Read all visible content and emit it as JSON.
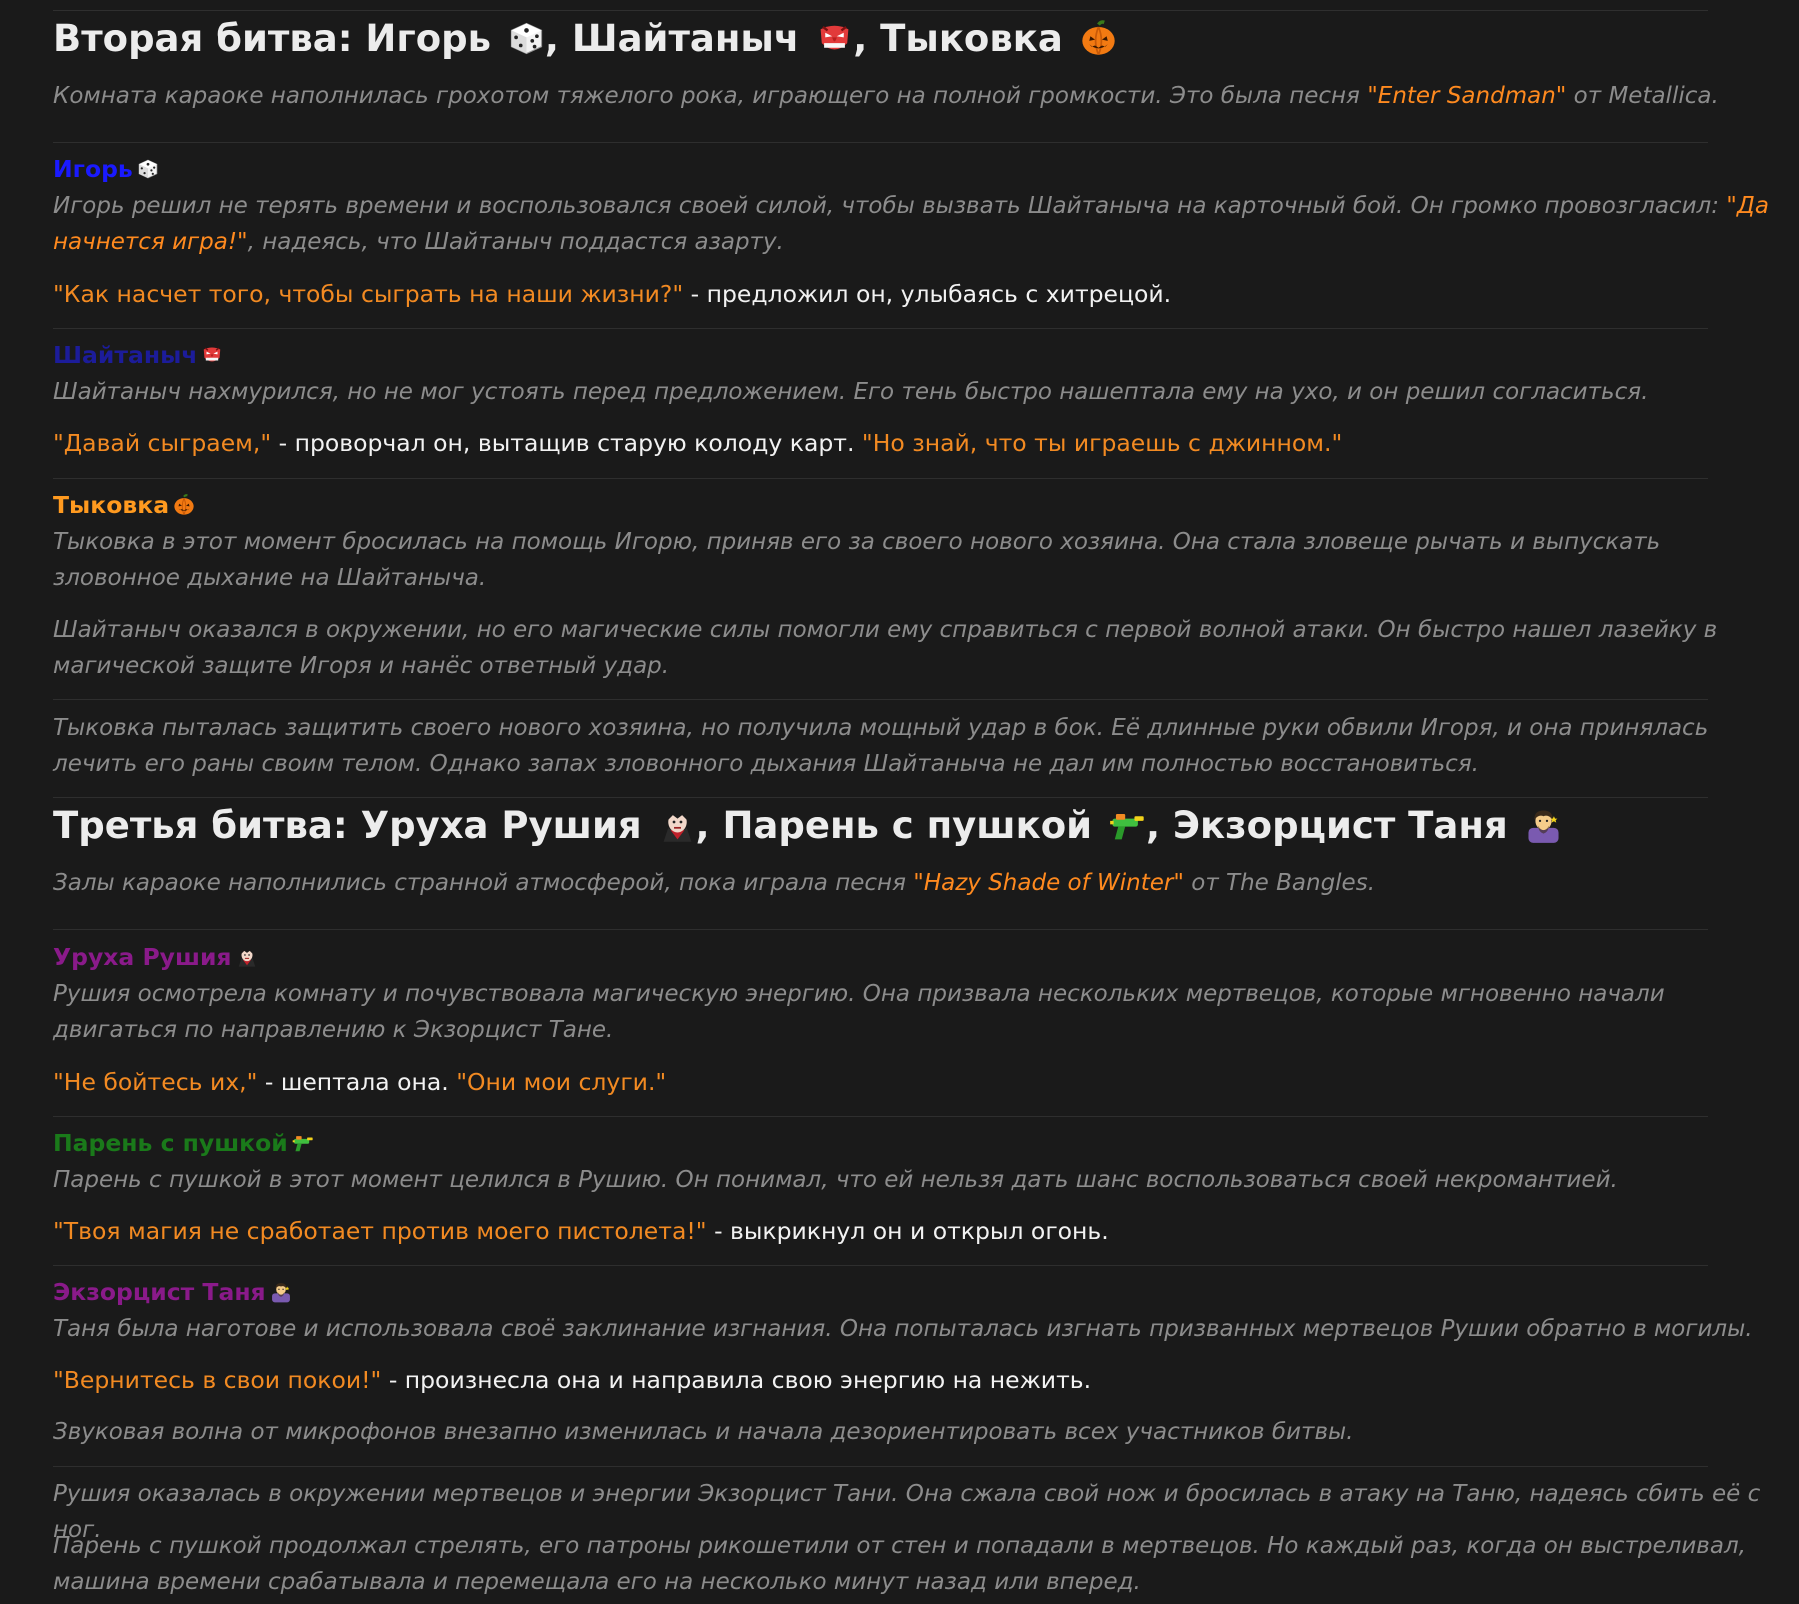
{
  "battle2": {
    "title_prefix": "Вторая битва: Игорь",
    "sep1": ", Шайтаныч",
    "sep2": ", Тыковка",
    "intro_a": "Комната караоке наполнилась грохотом тяжелого рока, играющего на полной громкости. Это была песня ",
    "intro_song": "\"Enter Sandman\"",
    "intro_b": " от Metallica.",
    "igor": {
      "name": "Игорь",
      "name_color": "#1a1aff",
      "narr_a": "Игорь решил не терять времени и воспользовался своей силой, чтобы вызвать Шайтаныча на карточный бой. Он громко провозгласил: ",
      "narr_quote": "\"Да начнется игра!\"",
      "narr_b": ", надеясь, что Шайтаныч поддастся азарту.",
      "speech_quote": "\"Как насчет того, чтобы сыграть на наши жизни?\"",
      "speech_rest": " - предложил он, улыбаясь с хитрецой."
    },
    "shaitanych": {
      "name": "Шайтаныч",
      "name_color": "#1c1c9a",
      "narr": "Шайтаныч нахмурился, но не мог устоять перед предложением. Его тень быстро нашептала ему на ухо, и он решил согласиться.",
      "speech_quote1": "\"Давай сыграем,\"",
      "speech_mid": " - проворчал он, вытащив старую колоду карт. ",
      "speech_quote2": "\"Но знай, что ты играешь с джинном.\""
    },
    "tykovka": {
      "name": "Тыковка",
      "name_color": "#ff9a1f",
      "narr1": "Тыковка в этот момент бросилась на помощь Игорю, приняв его за своего нового хозяина. Она стала зловеще рычать и выпускать зловонное дыхание на Шайтаныча.",
      "narr2": "Шайтаныч оказался в окружении, но его магические силы помогли ему справиться с первой волной атаки. Он быстро нашел лазейку в магической защите Игоря и нанёс ответный удар.",
      "narr3": "Тыковка пыталась защитить своего нового хозяина, но получила мощный удар в бок. Её длинные руки обвили Игоря, и она принялась лечить его раны своим телом. Однако запах зловонного дыхания Шайтаныча не дал им полностью восстановиться."
    }
  },
  "battle3": {
    "title_prefix": "Третья битва: Уруха Рушия",
    "sep1": ", Парень с пушкой",
    "sep2": ", Экзорцист Таня",
    "intro_a": "Залы караоке наполнились странной атмосферой, пока играла песня ",
    "intro_song": "\"Hazy Shade of Winter\"",
    "intro_b": " от The Bangles.",
    "rushiya": {
      "name": "Уруха Рушия",
      "name_color": "#8a1a8a",
      "narr": "Рушия осмотрела комнату и почувствовала магическую энергию. Она призвала нескольких мертвецов, которые мгновенно начали двигаться по направлению к Экзорцист Тане.",
      "speech_quote1": "\"Не бойтесь их,\"",
      "speech_mid": " - шептала она. ",
      "speech_quote2": "\"Они мои слуги.\""
    },
    "gunguy": {
      "name": "Парень с пушкой",
      "name_color": "#1a7a1a",
      "narr": "Парень с пушкой в этот момент целился в Рушию. Он понимал, что ей нельзя дать шанс воспользоваться своей некромантией.",
      "speech_quote": "\"Твоя магия не сработает против моего пистолета!\"",
      "speech_rest": " - выкрикнул он и открыл огонь."
    },
    "tanya": {
      "name": "Экзорцист Таня",
      "name_color": "#8a1a8a",
      "narr": "Таня была наготове и использовала своё заклинание изгнания. Она попыталась изгнать призванных мертвецов Рушии обратно в могилы.",
      "speech_quote": "\"Вернитесь в свои покои!\"",
      "speech_rest": " - произнесла она и направила свою энергию на нежить."
    },
    "narr_wave": "Звуковая волна от микрофонов внезапно изменилась и начала дезориентировать всех участников битвы.",
    "narr_rushiya": "Рушия оказалась в окружении мертвецов и энергии Экзорцист Тани. Она сжала свой нож и бросилась в атаку на Таню, надеясь сбить её с ног.",
    "narr_gun": "Парень с пушкой продолжал стрелять, его патроны рикошетили от стен и попадали в мертвецов. Но каждый раз, когда он выстреливал, машина времени срабатывала и перемещала его на несколько минут назад или вперед."
  },
  "icons": [
    "dice-icon",
    "goblin-mask-icon",
    "pumpkin-icon",
    "vampire-icon",
    "water-gun-icon",
    "mage-icon"
  ]
}
